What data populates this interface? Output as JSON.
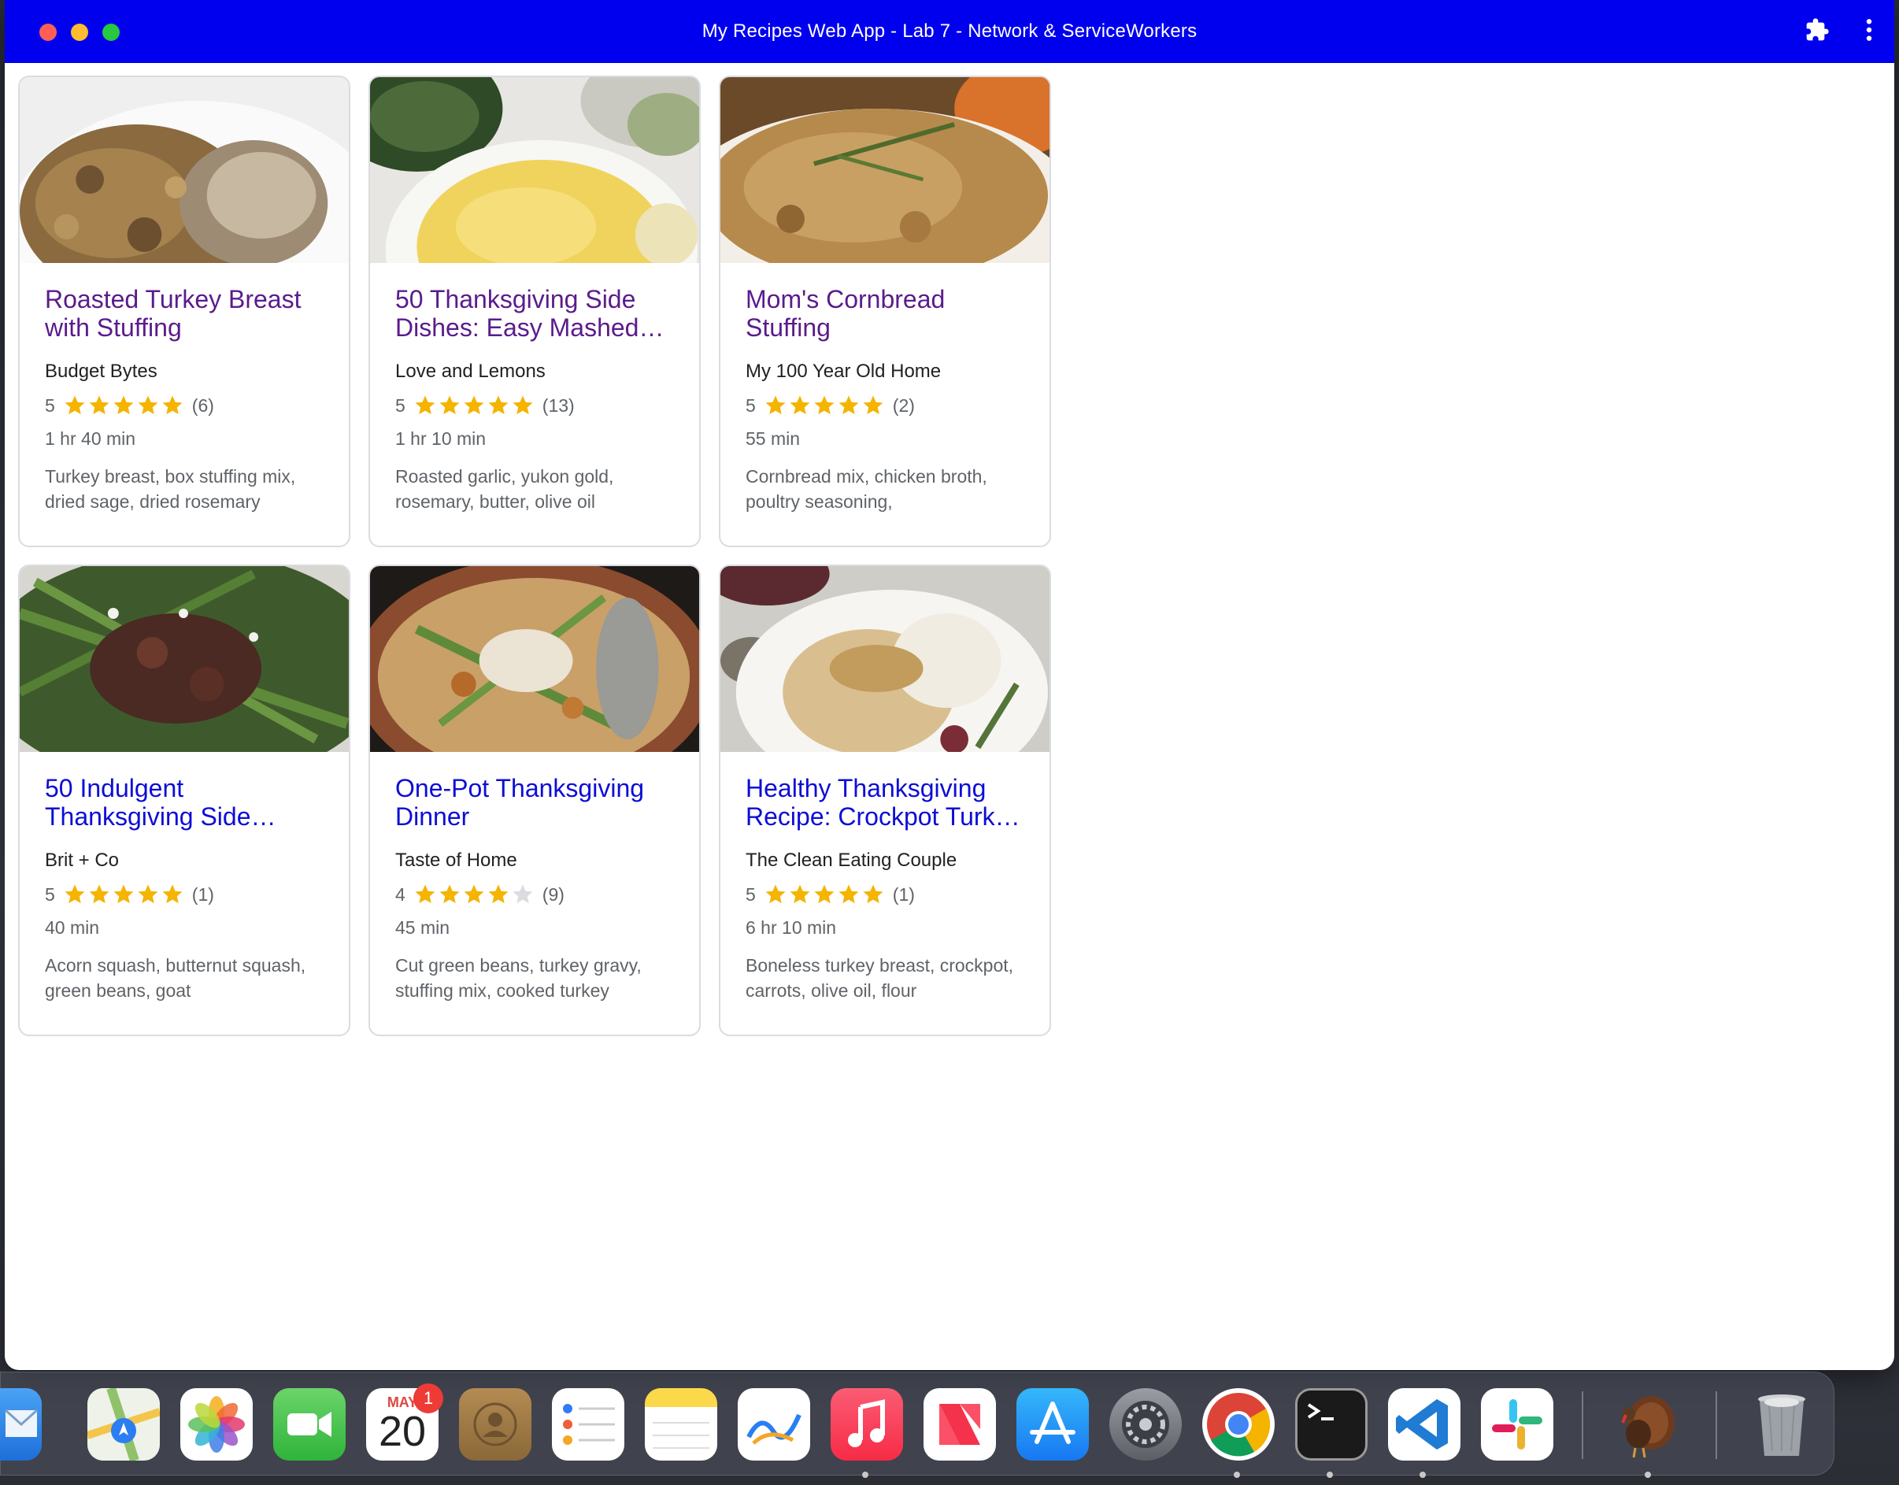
{
  "window": {
    "title": "My Recipes Web App - Lab 7 - Network & ServiceWorkers",
    "titlebar_color": "#0000ee"
  },
  "recipes": [
    {
      "title": "Roasted Turkey Breast with Stuffing",
      "source": "Budget Bytes",
      "rating": "5",
      "stars": 5,
      "reviews": "(6)",
      "time": "1 hr 40 min",
      "ingredients": "Turkey breast, box stuffing mix, dried sage, dried rosemary",
      "visited": true,
      "image": "turkey-stuffing-photo"
    },
    {
      "title": "50 Thanksgiving Side Dishes: Easy Mashed…",
      "source": "Love and Lemons",
      "rating": "5",
      "stars": 5,
      "reviews": "(13)",
      "time": "1 hr 10 min",
      "ingredients": "Roasted garlic, yukon gold, rosemary, butter, olive oil",
      "visited": true,
      "image": "mashed-potatoes-photo"
    },
    {
      "title": "Mom's Cornbread Stuffing",
      "source": "My 100 Year Old Home",
      "rating": "5",
      "stars": 5,
      "reviews": "(2)",
      "time": "55 min",
      "ingredients": "Cornbread mix, chicken broth, poultry seasoning,",
      "visited": true,
      "image": "cornbread-stuffing-photo"
    },
    {
      "title": "50 Indulgent Thanksgiving Side…",
      "source": "Brit + Co",
      "rating": "5",
      "stars": 5,
      "reviews": "(1)",
      "time": "40 min",
      "ingredients": "Acorn squash, butternut squash, green beans, goat",
      "visited": false,
      "image": "green-beans-photo"
    },
    {
      "title": "One-Pot Thanksgiving Dinner",
      "source": "Taste of Home",
      "rating": "4",
      "stars": 4,
      "reviews": "(9)",
      "time": "45 min",
      "ingredients": "Cut green beans, turkey gravy, stuffing mix, cooked turkey",
      "visited": false,
      "image": "one-pot-dinner-photo"
    },
    {
      "title": "Healthy Thanksgiving Recipe: Crockpot Turk…",
      "source": "The Clean Eating Couple",
      "rating": "5",
      "stars": 5,
      "reviews": "(1)",
      "time": "6 hr 10 min",
      "ingredients": "Boneless turkey breast, crockpot, carrots, olive oil, flour",
      "visited": false,
      "image": "crockpot-turkey-photo"
    }
  ],
  "colors": {
    "visited_link": "#5b1b8c",
    "link": "#0d0dd6",
    "star": "#f4b400",
    "star_empty": "#dadce0"
  },
  "dock": {
    "calendar_month": "MAY",
    "calendar_day": "20",
    "calendar_badge": "1",
    "apps": [
      "mail-icon",
      "maps-icon",
      "photos-icon",
      "facetime-icon",
      "calendar-icon",
      "contacts-icon",
      "reminders-icon",
      "notes-icon",
      "freeform-icon",
      "music-icon",
      "news-icon",
      "app-store-icon",
      "system-settings-icon",
      "chrome-icon",
      "terminal-icon",
      "vscode-icon",
      "slack-icon",
      "turkey-app-icon",
      "trash-icon"
    ]
  }
}
